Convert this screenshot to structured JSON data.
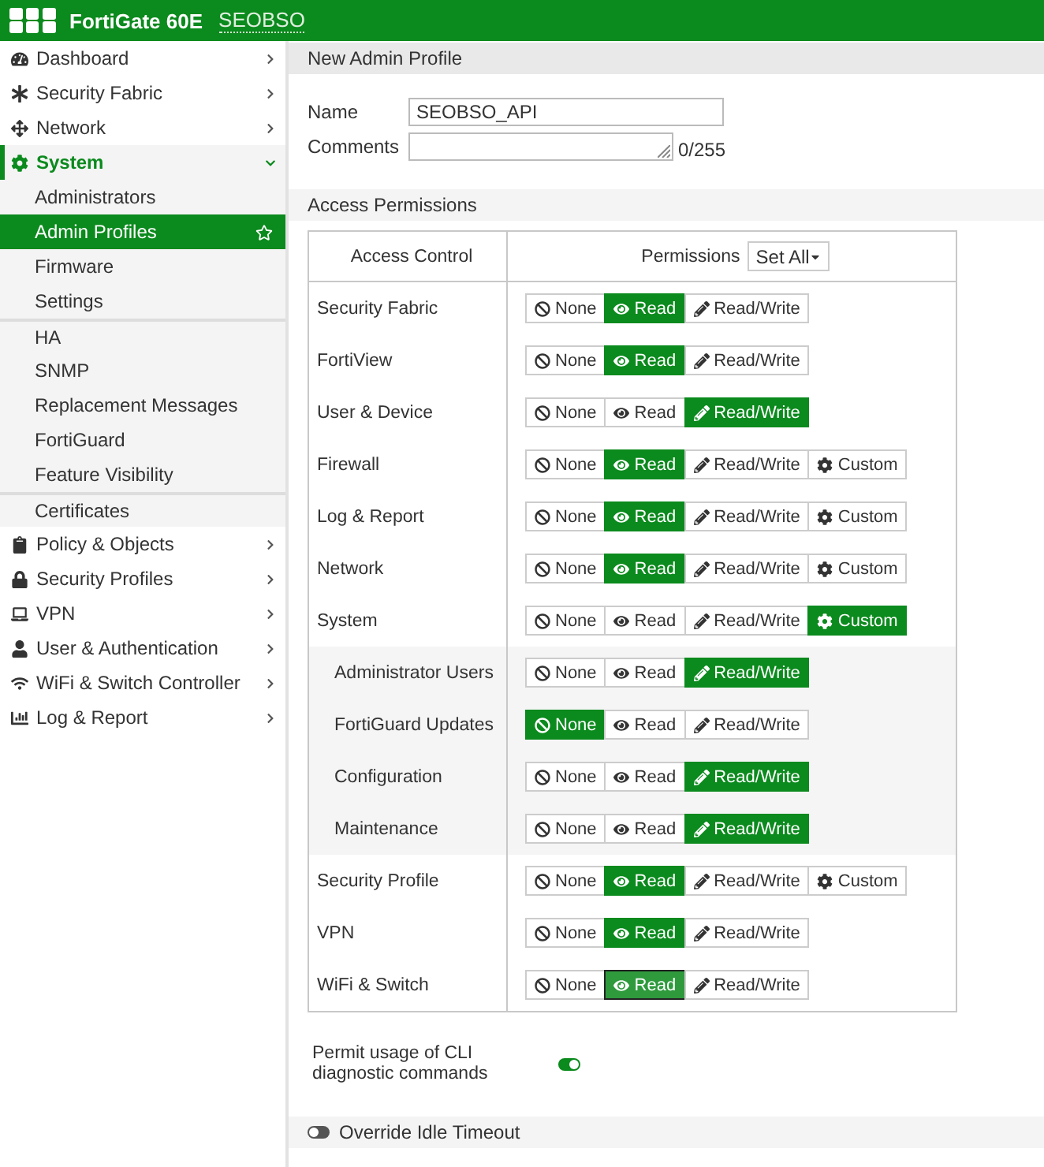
{
  "header": {
    "product": "FortiGate 60E",
    "hostname": "SEOBSO"
  },
  "sidebar": {
    "items": [
      {
        "kind": "dashboard",
        "label": "Dashboard",
        "expanded": false,
        "selected": false
      },
      {
        "kind": "fabric",
        "label": "Security Fabric",
        "expanded": false,
        "selected": false
      },
      {
        "kind": "network",
        "label": "Network",
        "expanded": false,
        "selected": false
      },
      {
        "kind": "system",
        "label": "System",
        "expanded": true,
        "selected": true,
        "children": [
          {
            "label": "Administrators",
            "selected": false,
            "separated": false
          },
          {
            "label": "Admin Profiles",
            "selected": true,
            "separated": false
          },
          {
            "label": "Firmware",
            "selected": false,
            "separated": false
          },
          {
            "label": "Settings",
            "selected": false,
            "separated": false
          },
          {
            "label": "HA",
            "selected": false,
            "separated": true
          },
          {
            "label": "SNMP",
            "selected": false,
            "separated": false
          },
          {
            "label": "Replacement Messages",
            "selected": false,
            "separated": false
          },
          {
            "label": "FortiGuard",
            "selected": false,
            "separated": false
          },
          {
            "label": "Feature Visibility",
            "selected": false,
            "separated": false
          },
          {
            "label": "Certificates",
            "selected": false,
            "separated": true
          }
        ]
      },
      {
        "kind": "policy",
        "label": "Policy & Objects",
        "expanded": false,
        "selected": false
      },
      {
        "kind": "security",
        "label": "Security Profiles",
        "expanded": false,
        "selected": false
      },
      {
        "kind": "vpn",
        "label": "VPN",
        "expanded": false,
        "selected": false
      },
      {
        "kind": "user",
        "label": "User & Authentication",
        "expanded": false,
        "selected": false
      },
      {
        "kind": "wifi",
        "label": "WiFi & Switch Controller",
        "expanded": false,
        "selected": false
      },
      {
        "kind": "log",
        "label": "Log & Report",
        "expanded": false,
        "selected": false
      }
    ]
  },
  "page_title": "New Admin Profile",
  "form": {
    "name": {
      "label": "Name",
      "value": "SEOBSO_API"
    },
    "comments": {
      "label": "Comments",
      "counter": "0/255"
    }
  },
  "access_permissions": {
    "title": "Access Permissions",
    "columns": [
      "Access Control",
      "Permissions"
    ],
    "set_all": "Set All",
    "rows": [
      {
        "label": "Security Fabric",
        "indented": false,
        "options": [
          {
            "kind": "none",
            "label": "None",
            "selected": false
          },
          {
            "kind": "read",
            "label": "Read",
            "selected": true
          },
          {
            "kind": "write",
            "label": "Read/Write",
            "selected": false
          }
        ]
      },
      {
        "label": "FortiView",
        "indented": false,
        "options": [
          {
            "kind": "none",
            "label": "None",
            "selected": false
          },
          {
            "kind": "read",
            "label": "Read",
            "selected": true
          },
          {
            "kind": "write",
            "label": "Read/Write",
            "selected": false
          }
        ]
      },
      {
        "label": "User & Device",
        "indented": false,
        "options": [
          {
            "kind": "none",
            "label": "None",
            "selected": false
          },
          {
            "kind": "read",
            "label": "Read",
            "selected": false
          },
          {
            "kind": "write",
            "label": "Read/Write",
            "selected": true
          }
        ]
      },
      {
        "label": "Firewall",
        "indented": false,
        "options": [
          {
            "kind": "none",
            "label": "None",
            "selected": false
          },
          {
            "kind": "read",
            "label": "Read",
            "selected": true
          },
          {
            "kind": "write",
            "label": "Read/Write",
            "selected": false
          },
          {
            "kind": "custom",
            "label": "Custom",
            "selected": false
          }
        ]
      },
      {
        "label": "Log & Report",
        "indented": false,
        "options": [
          {
            "kind": "none",
            "label": "None",
            "selected": false
          },
          {
            "kind": "read",
            "label": "Read",
            "selected": true
          },
          {
            "kind": "write",
            "label": "Read/Write",
            "selected": false
          },
          {
            "kind": "custom",
            "label": "Custom",
            "selected": false
          }
        ]
      },
      {
        "label": "Network",
        "indented": false,
        "options": [
          {
            "kind": "none",
            "label": "None",
            "selected": false
          },
          {
            "kind": "read",
            "label": "Read",
            "selected": true
          },
          {
            "kind": "write",
            "label": "Read/Write",
            "selected": false
          },
          {
            "kind": "custom",
            "label": "Custom",
            "selected": false
          }
        ]
      },
      {
        "label": "System",
        "indented": false,
        "options": [
          {
            "kind": "none",
            "label": "None",
            "selected": false
          },
          {
            "kind": "read",
            "label": "Read",
            "selected": false
          },
          {
            "kind": "write",
            "label": "Read/Write",
            "selected": false
          },
          {
            "kind": "custom",
            "label": "Custom",
            "selected": true
          }
        ]
      },
      {
        "label": "Administrator Users",
        "indented": true,
        "options": [
          {
            "kind": "none",
            "label": "None",
            "selected": false
          },
          {
            "kind": "read",
            "label": "Read",
            "selected": false
          },
          {
            "kind": "write",
            "label": "Read/Write",
            "selected": true
          }
        ]
      },
      {
        "label": "FortiGuard Updates",
        "indented": true,
        "options": [
          {
            "kind": "none",
            "label": "None",
            "selected": true
          },
          {
            "kind": "read",
            "label": "Read",
            "selected": false
          },
          {
            "kind": "write",
            "label": "Read/Write",
            "selected": false
          }
        ]
      },
      {
        "label": "Configuration",
        "indented": true,
        "options": [
          {
            "kind": "none",
            "label": "None",
            "selected": false
          },
          {
            "kind": "read",
            "label": "Read",
            "selected": false
          },
          {
            "kind": "write",
            "label": "Read/Write",
            "selected": true
          }
        ]
      },
      {
        "label": "Maintenance",
        "indented": true,
        "options": [
          {
            "kind": "none",
            "label": "None",
            "selected": false
          },
          {
            "kind": "read",
            "label": "Read",
            "selected": false
          },
          {
            "kind": "write",
            "label": "Read/Write",
            "selected": true
          }
        ]
      },
      {
        "label": "Security Profile",
        "indented": false,
        "options": [
          {
            "kind": "none",
            "label": "None",
            "selected": false
          },
          {
            "kind": "read",
            "label": "Read",
            "selected": true
          },
          {
            "kind": "write",
            "label": "Read/Write",
            "selected": false
          },
          {
            "kind": "custom",
            "label": "Custom",
            "selected": false
          }
        ]
      },
      {
        "label": "VPN",
        "indented": false,
        "options": [
          {
            "kind": "none",
            "label": "None",
            "selected": false
          },
          {
            "kind": "read",
            "label": "Read",
            "selected": true
          },
          {
            "kind": "write",
            "label": "Read/Write",
            "selected": false
          }
        ]
      },
      {
        "label": "WiFi & Switch",
        "indented": false,
        "options": [
          {
            "kind": "none",
            "label": "None",
            "selected": false
          },
          {
            "kind": "read",
            "label": "Read",
            "selected": true,
            "focused": true
          },
          {
            "kind": "write",
            "label": "Read/Write",
            "selected": false
          }
        ]
      }
    ]
  },
  "cli_diagnostics": {
    "label": "Permit usage of CLI diagnostic commands",
    "on": true
  },
  "idle_timeout": {
    "label": "Override Idle Timeout",
    "on": false
  }
}
